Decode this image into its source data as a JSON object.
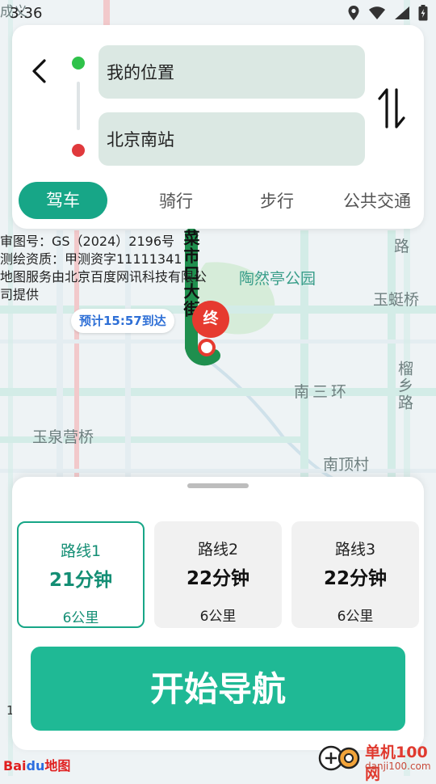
{
  "status_bar": {
    "time": "3:36"
  },
  "route_input": {
    "from": "我的位置",
    "to": "北京南站"
  },
  "mode_tabs": [
    {
      "label": "驾车",
      "active": true
    },
    {
      "label": "骑行",
      "active": false
    },
    {
      "label": "步行",
      "active": false
    },
    {
      "label": "公共交通",
      "active": false
    }
  ],
  "map": {
    "copyright_lines": [
      "审图号：GS（2024）2196号",
      "测绘资质：甲测资字11111341",
      "地图服务由北京百度网讯科技有限公",
      "司提供"
    ],
    "eta_label": "预计15:57到达",
    "end_marker": "终",
    "labels": {
      "park": "陶然亭公园",
      "road_vertical": "菜市口大街",
      "yuting": "玉蜓桥",
      "nansanhuan": "南三环",
      "liuxiang": "榴乡路",
      "yuquanying": "玉泉营桥",
      "nandingcun": "南顶村",
      "lu": "路",
      "chengyi": "成义",
      "corner_1": "1"
    }
  },
  "routes": [
    {
      "name": "路线1",
      "duration": "21分钟",
      "distance": "6公里",
      "selected": true
    },
    {
      "name": "路线2",
      "duration": "22分钟",
      "distance": "6公里",
      "selected": false
    },
    {
      "name": "路线3",
      "duration": "22分钟",
      "distance": "6公里",
      "selected": false
    }
  ],
  "start_button": "开始导航",
  "baidu_logo": {
    "part1": "Bai",
    "part2": "du",
    "part3": "地图"
  },
  "watermark": {
    "line1": "单机100网",
    "line2": "danji100.com"
  },
  "colors": {
    "accent": "#17a687",
    "button": "#1fb995",
    "start_dot": "#2fc24a",
    "end_dot": "#e0393c",
    "route_line": "#1f8f4e",
    "eta_text": "#2e6fd6"
  }
}
